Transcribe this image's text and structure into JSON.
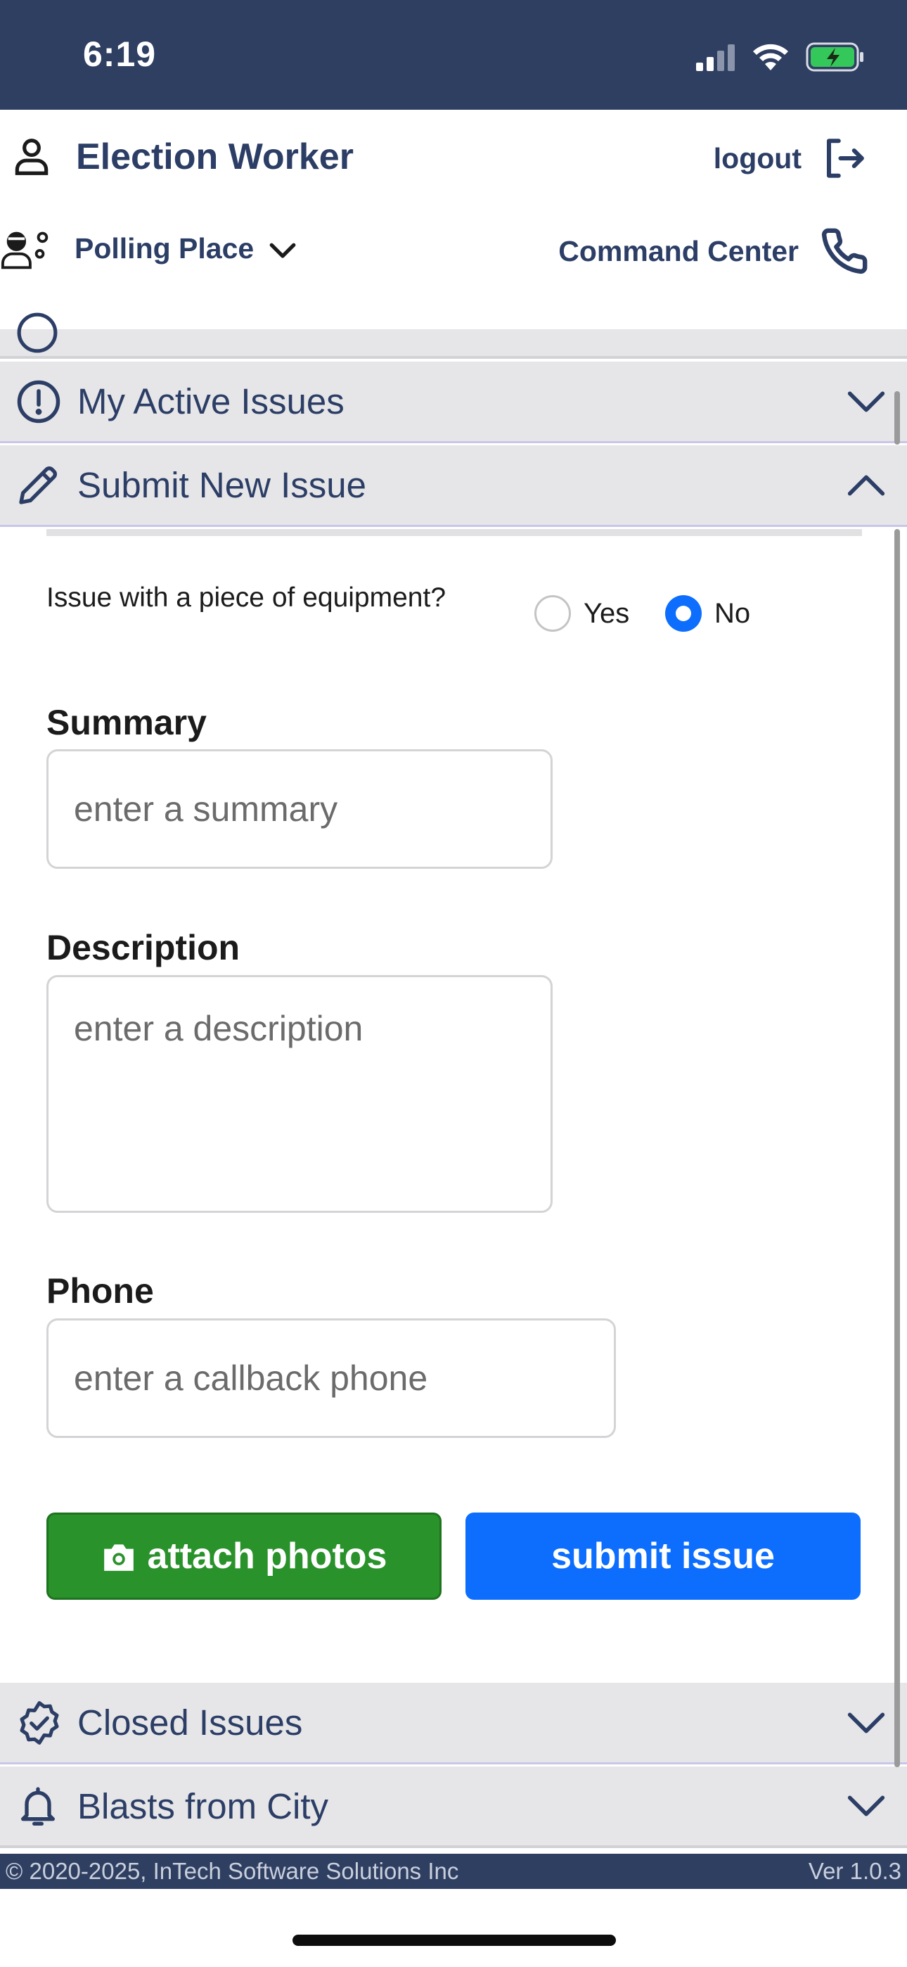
{
  "status_bar": {
    "time": "6:19",
    "signal_icon": "signal-icon",
    "wifi_icon": "wifi-icon",
    "battery_icon": "battery-charging-icon"
  },
  "header": {
    "user_title": "Election Worker",
    "logout_label": "logout",
    "polling_place_label": "Polling Place",
    "command_center_label": "Command Center"
  },
  "accordion": {
    "active_issues": "My Active Issues",
    "submit_new_issue": "Submit New Issue",
    "closed_issues": "Closed Issues",
    "blasts": "Blasts from City"
  },
  "form": {
    "equipment_question": "Issue with a piece of equipment?",
    "option_yes": "Yes",
    "option_no": "No",
    "selected_option": "No",
    "summary_label": "Summary",
    "summary_placeholder": "enter a summary",
    "description_label": "Description",
    "description_placeholder": "enter a description",
    "phone_label": "Phone",
    "phone_placeholder": "enter a callback phone",
    "attach_label": "attach photos",
    "submit_label": "submit issue"
  },
  "footer": {
    "copyright": "© 2020-2025, InTech Software Solutions Inc",
    "version": "Ver 1.0.3"
  },
  "colors": {
    "navy": "#2f3f62",
    "brand_text": "#2c3e66",
    "primary_blue": "#0d6efd",
    "success_green": "#2a922b",
    "section_bg": "#e6e6e8"
  }
}
